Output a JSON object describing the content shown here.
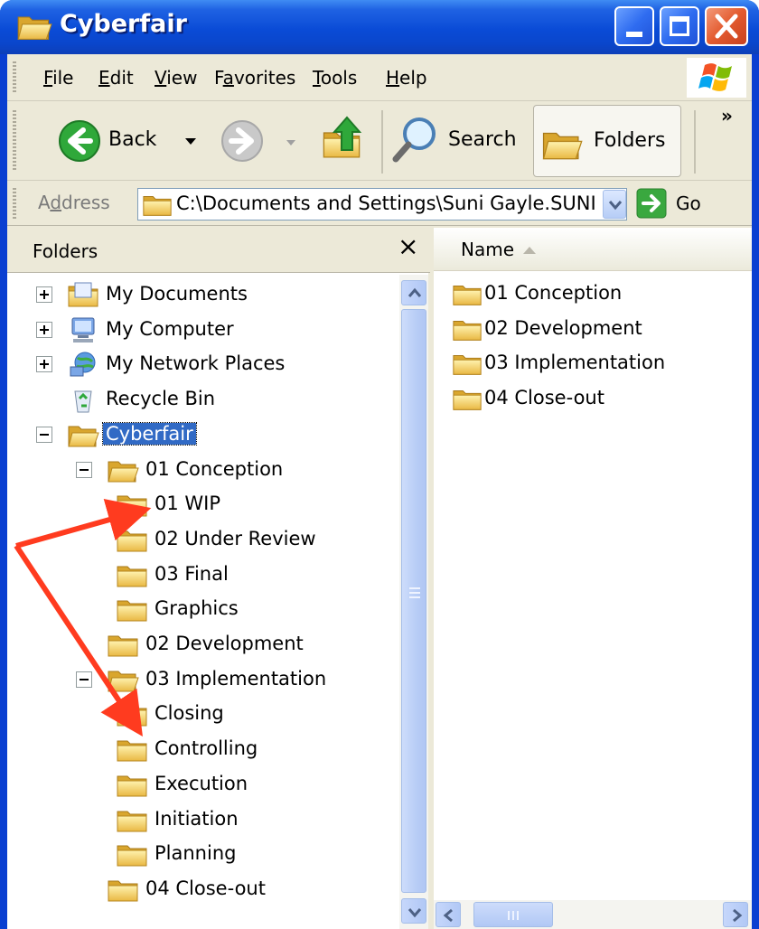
{
  "window": {
    "title": "Cyberfair"
  },
  "menu": {
    "items": [
      {
        "pre": "",
        "u": "F",
        "post": "ile"
      },
      {
        "pre": "",
        "u": "E",
        "post": "dit"
      },
      {
        "pre": "",
        "u": "V",
        "post": "iew"
      },
      {
        "pre": "F",
        "u": "a",
        "post": "vorites"
      },
      {
        "pre": "",
        "u": "T",
        "post": "ools"
      },
      {
        "pre": "",
        "u": "H",
        "post": "elp"
      }
    ]
  },
  "toolbar": {
    "back": "Back",
    "search": "Search",
    "folders": "Folders",
    "overflow": "»"
  },
  "address": {
    "label_pre": "A",
    "label_u": "d",
    "label_post": "dress",
    "value": "C:\\Documents and Settings\\Suni Gayle.SUNI",
    "go": "Go"
  },
  "folders_pane": {
    "title": "Folders",
    "close": "×",
    "tree": [
      {
        "label": "My Documents",
        "expander": "plus",
        "icon": "my-documents-icon"
      },
      {
        "label": "My Computer",
        "expander": "plus",
        "icon": "my-computer-icon"
      },
      {
        "label": "My Network Places",
        "expander": "plus",
        "icon": "network-places-icon"
      },
      {
        "label": "Recycle Bin",
        "expander": "none",
        "icon": "recycle-bin-icon"
      },
      {
        "label": "Cyberfair",
        "expander": "minus",
        "icon": "folder-open-icon",
        "selected": true
      },
      {
        "label": "01 Conception",
        "expander": "minus",
        "icon": "folder-open-icon"
      },
      {
        "label": "01 WIP",
        "expander": "none",
        "icon": "folder-icon"
      },
      {
        "label": "02 Under Review",
        "expander": "none",
        "icon": "folder-icon"
      },
      {
        "label": "03 Final",
        "expander": "none",
        "icon": "folder-icon"
      },
      {
        "label": "Graphics",
        "expander": "none",
        "icon": "folder-icon"
      },
      {
        "label": "02 Development",
        "expander": "none",
        "icon": "folder-icon"
      },
      {
        "label": "03 Implementation",
        "expander": "minus",
        "icon": "folder-open-icon"
      },
      {
        "label": "Closing",
        "expander": "none",
        "icon": "folder-icon"
      },
      {
        "label": "Controlling",
        "expander": "none",
        "icon": "folder-icon"
      },
      {
        "label": "Execution",
        "expander": "none",
        "icon": "folder-icon"
      },
      {
        "label": "Initiation",
        "expander": "none",
        "icon": "folder-icon"
      },
      {
        "label": "Planning",
        "expander": "none",
        "icon": "folder-icon"
      },
      {
        "label": "04 Close-out",
        "expander": "none",
        "icon": "folder-icon"
      }
    ]
  },
  "list_pane": {
    "column": "Name",
    "items": [
      "01 Conception",
      "02 Development",
      "03 Implementation",
      "04 Close-out"
    ]
  },
  "colors": {
    "titlebar": "#0a4bd6",
    "selection": "#316ac5",
    "annotation_arrow": "#ff3b1f",
    "chrome": "#ece9d8"
  }
}
